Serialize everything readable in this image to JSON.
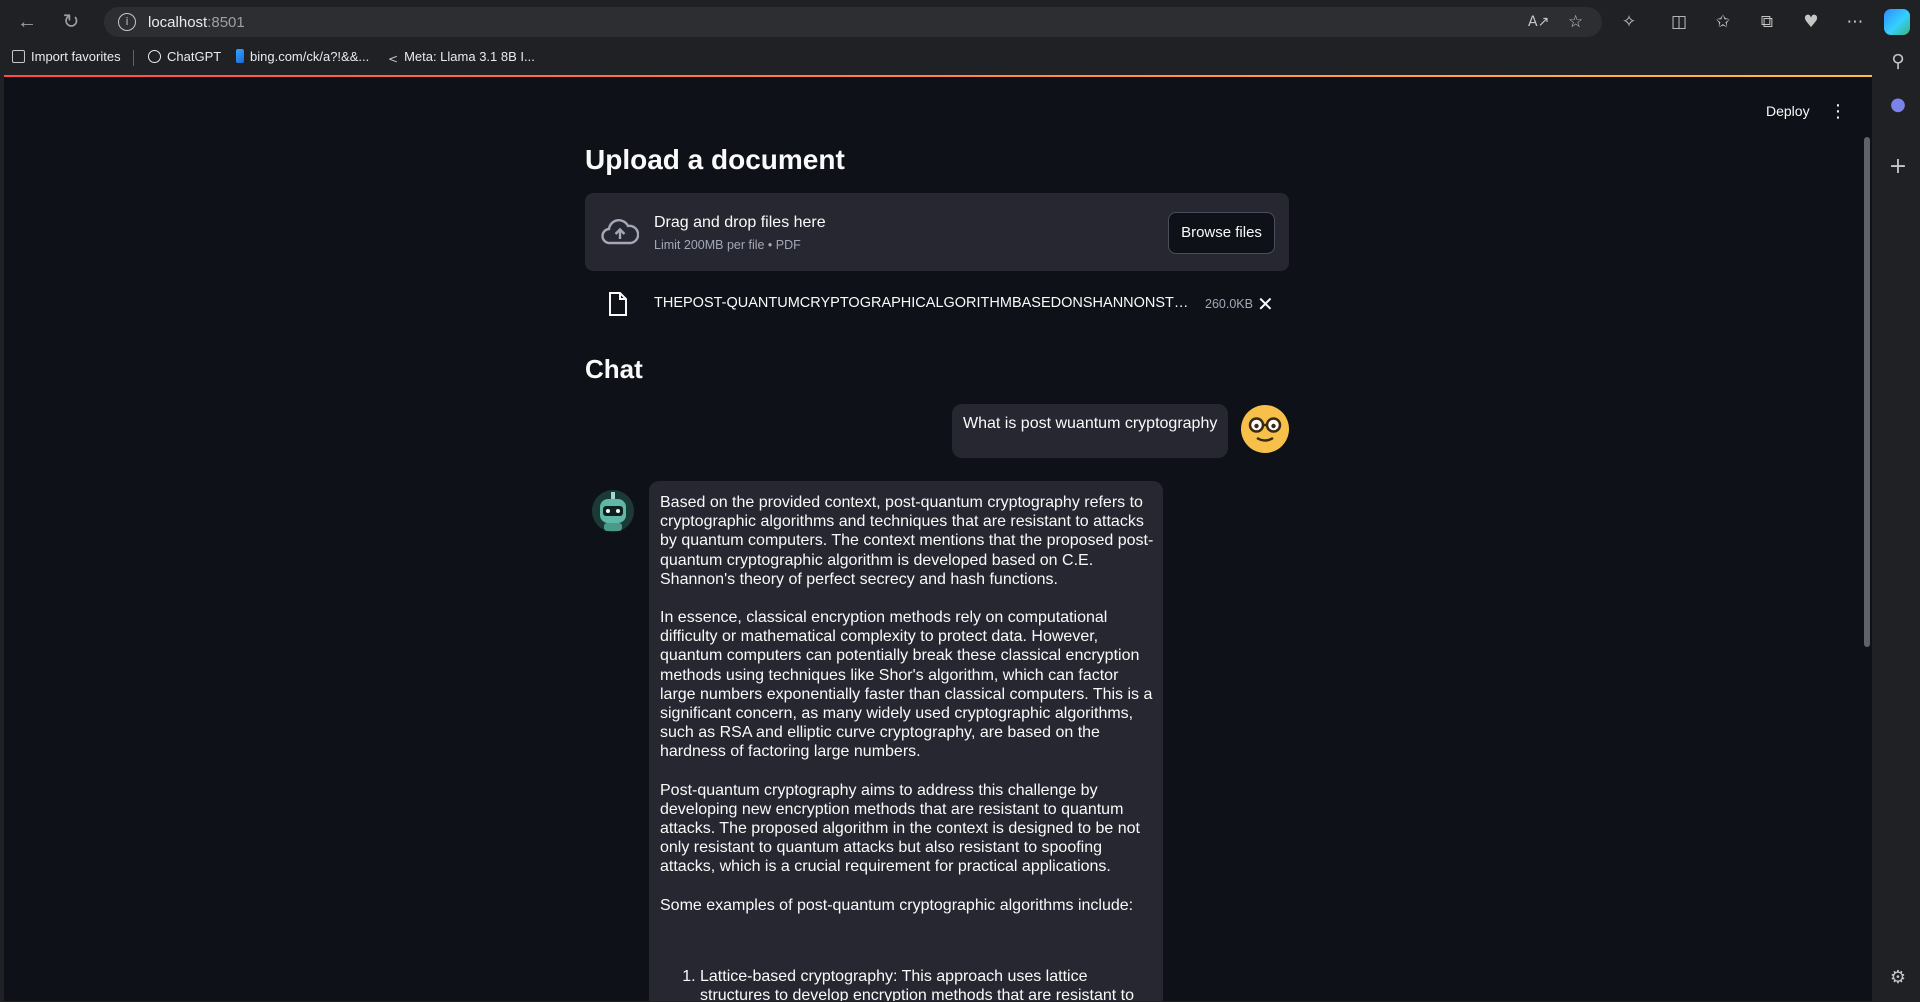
{
  "browser": {
    "url_host": "localhost",
    "url_port": ":8501",
    "favorites": [
      {
        "label": "Import favorites"
      },
      {
        "label": "ChatGPT"
      },
      {
        "label": "bing.com/ck/a?!&&..."
      },
      {
        "label": "Meta: Llama 3.1 8B I..."
      }
    ]
  },
  "app": {
    "deploy_label": "Deploy",
    "title": "Upload a document",
    "uploader": {
      "drag_text": "Drag and drop files here",
      "limit_text": "Limit 200MB per file • PDF",
      "browse_label": "Browse files"
    },
    "file": {
      "name": "THEPOST-QUANTUMCRYPTOGRAPHICALGORITHMBASEDONSHANNONSTHEOREM.pdf",
      "size": "260.0KB"
    },
    "chat_heading": "Chat",
    "messages": {
      "user": "What is post wuantum cryptography",
      "assistant": {
        "p1": "Based on the provided context, post-quantum cryptography refers to cryptographic algorithms and techniques that are resistant to attacks by quantum computers. The context mentions that the proposed post-quantum cryptographic algorithm is developed based on C.E. Shannon's theory of perfect secrecy and hash functions.",
        "p2": "In essence, classical encryption methods rely on computational difficulty or mathematical complexity to protect data. However, quantum computers can potentially break these classical encryption methods using techniques like Shor's algorithm, which can factor large numbers exponentially faster than classical computers. This is a significant concern, as many widely used cryptographic algorithms, such as RSA and elliptic curve cryptography, are based on the hardness of factoring large numbers.",
        "p3": "Post-quantum cryptography aims to address this challenge by developing new encryption methods that are resistant to quantum attacks. The proposed algorithm in the context is designed to be not only resistant to quantum attacks but also resistant to spoofing attacks, which is a crucial requirement for practical applications.",
        "p4": "Some examples of post-quantum cryptographic algorithms include:",
        "list": [
          "Lattice-based cryptography: This approach uses lattice structures to develop encryption methods that are resistant to"
        ]
      }
    }
  },
  "colors": {
    "page_bg": "#0e1117",
    "widget_bg": "#262730",
    "accent_gradient_start": "#ff4b4b",
    "accent_gradient_end": "#ffbd45"
  }
}
